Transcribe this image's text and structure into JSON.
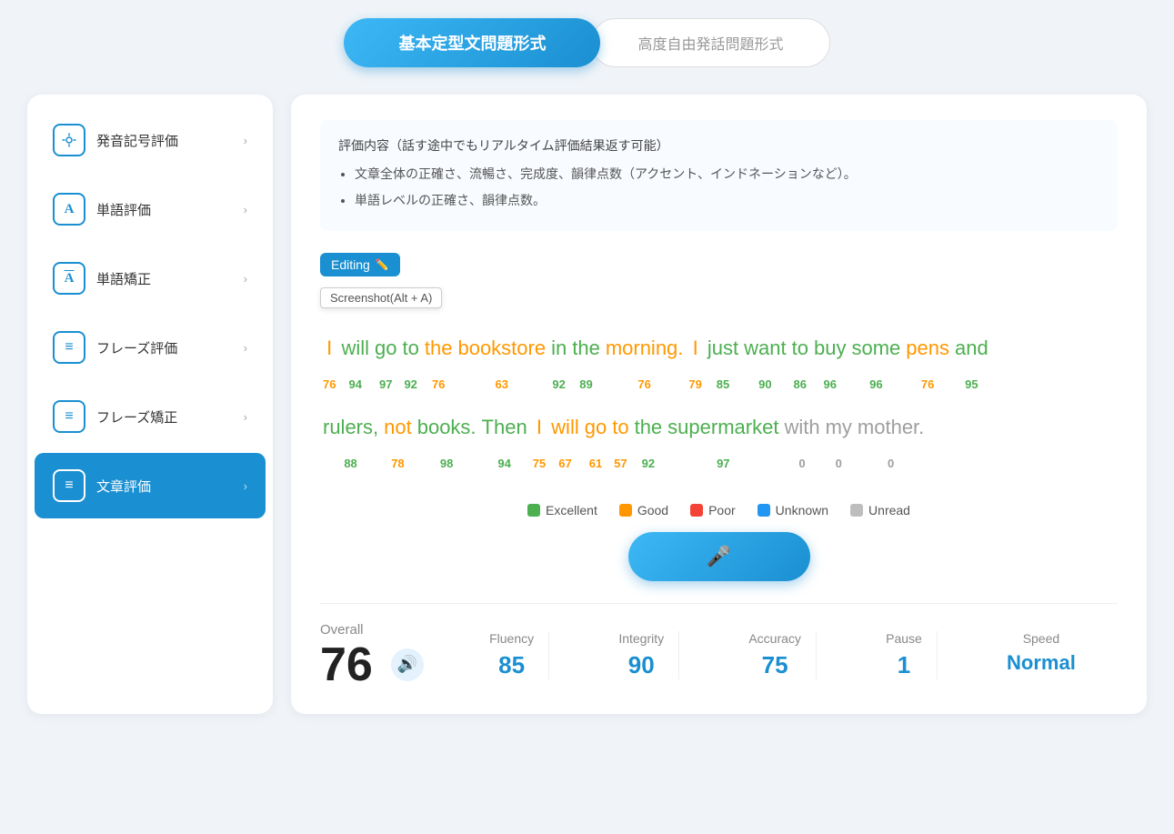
{
  "tabs": {
    "active_label": "基本定型文問題形式",
    "inactive_label": "高度自由発話問題形式"
  },
  "sidebar": {
    "items": [
      {
        "id": "pronunciation",
        "label": "発音記号評価",
        "icon": "🔊",
        "active": false
      },
      {
        "id": "word-eval",
        "label": "単語評価",
        "icon": "A",
        "active": false
      },
      {
        "id": "word-correction",
        "label": "単語矯正",
        "icon": "A",
        "active": false
      },
      {
        "id": "phrase-eval",
        "label": "フレーズ評価",
        "icon": "≡",
        "active": false
      },
      {
        "id": "phrase-correction",
        "label": "フレーズ矯正",
        "icon": "☰",
        "active": false
      },
      {
        "id": "sentence-eval",
        "label": "文章評価",
        "icon": "☰",
        "active": true
      }
    ]
  },
  "content": {
    "description_title": "評価内容（話す途中でもリアルタイム評価結果返す可能）",
    "description_items": [
      "文章全体の正確さ、流暢さ、完成度、韻律点数（アクセント、インドネーションなど）。",
      "単語レベルの正確さ、韻律点数。"
    ],
    "editing_label": "Editing",
    "screenshot_tooltip": "Screenshot(Alt + A)",
    "sentence_line1": [
      {
        "word": "I",
        "score": "76",
        "color": "good"
      },
      {
        "word": "will",
        "score": "94",
        "color": "excellent"
      },
      {
        "word": "go",
        "score": "97",
        "color": "excellent"
      },
      {
        "word": "to",
        "score": "92",
        "color": "excellent"
      },
      {
        "word": "the",
        "score": "76",
        "color": "good"
      },
      {
        "word": "bookstore",
        "score": "63",
        "color": "good"
      },
      {
        "word": "in",
        "score": "92",
        "color": "excellent"
      },
      {
        "word": "the",
        "score": "89",
        "color": "excellent"
      },
      {
        "word": "morning.",
        "score": "76",
        "color": "good"
      },
      {
        "word": "I",
        "score": "79",
        "color": "good"
      },
      {
        "word": "just",
        "score": "85",
        "color": "excellent"
      },
      {
        "word": "want",
        "score": "90",
        "color": "excellent"
      },
      {
        "word": "to",
        "score": "86",
        "color": "excellent"
      },
      {
        "word": "buy",
        "score": "96",
        "color": "excellent"
      },
      {
        "word": "some",
        "score": "96",
        "color": "excellent"
      },
      {
        "word": "pens",
        "score": "76",
        "color": "good"
      },
      {
        "word": "and",
        "score": "95",
        "color": "excellent"
      }
    ],
    "sentence_line2": [
      {
        "word": "rulers,",
        "score": "88",
        "color": "excellent"
      },
      {
        "word": "not",
        "score": "78",
        "color": "good"
      },
      {
        "word": "books.",
        "score": "98",
        "color": "excellent"
      },
      {
        "word": "Then",
        "score": "94",
        "color": "excellent"
      },
      {
        "word": "I",
        "score": "75",
        "color": "good"
      },
      {
        "word": "will",
        "score": "67",
        "color": "good"
      },
      {
        "word": "go",
        "score": "61",
        "color": "good"
      },
      {
        "word": "to",
        "score": "57",
        "color": "good"
      },
      {
        "word": "the",
        "score": "92",
        "color": "excellent"
      },
      {
        "word": "supermarket",
        "score": "97",
        "color": "excellent"
      },
      {
        "word": "with",
        "score": "0",
        "color": "unread"
      },
      {
        "word": "my",
        "score": "0",
        "color": "unread"
      },
      {
        "word": "mother.",
        "score": "0",
        "color": "unread"
      }
    ],
    "legend": [
      {
        "label": "Excellent",
        "color_class": "dot-excellent"
      },
      {
        "label": "Good",
        "color_class": "dot-good"
      },
      {
        "label": "Poor",
        "color_class": "dot-poor"
      },
      {
        "label": "Unknown",
        "color_class": "dot-unknown"
      },
      {
        "label": "Unread",
        "color_class": "dot-unread"
      }
    ],
    "scores": {
      "overall_label": "Overall",
      "overall_value": "76",
      "metrics": [
        {
          "label": "Fluency",
          "value": "85",
          "is_text": false
        },
        {
          "label": "Integrity",
          "value": "90",
          "is_text": false
        },
        {
          "label": "Accuracy",
          "value": "75",
          "is_text": false
        },
        {
          "label": "Pause",
          "value": "1",
          "is_text": false
        },
        {
          "label": "Speed",
          "value": "Normal",
          "is_text": true
        }
      ]
    }
  }
}
